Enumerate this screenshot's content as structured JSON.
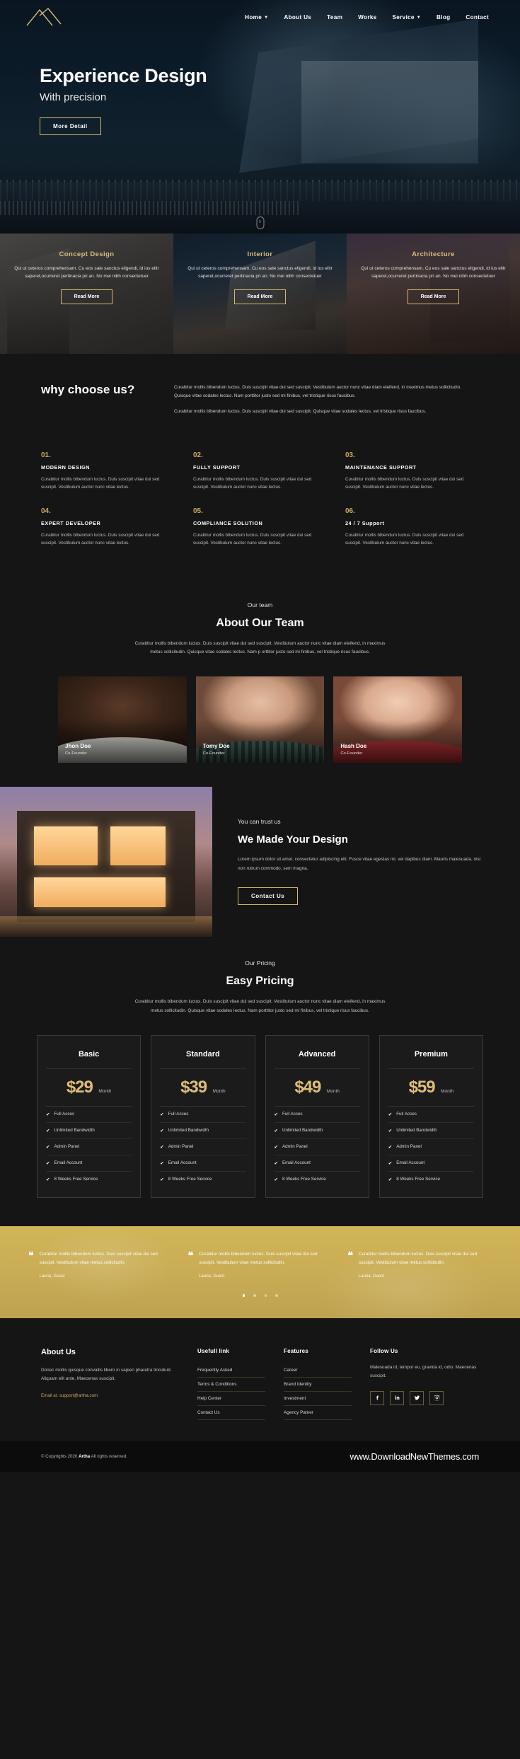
{
  "nav": {
    "logo_name": "artha-mountain-logo",
    "items": [
      {
        "label": "Home",
        "has_caret": true
      },
      {
        "label": "About Us",
        "has_caret": false
      },
      {
        "label": "Team",
        "has_caret": false
      },
      {
        "label": "Works",
        "has_caret": false
      },
      {
        "label": "Service",
        "has_caret": true
      },
      {
        "label": "Blog",
        "has_caret": false
      },
      {
        "label": "Contact",
        "has_caret": false
      }
    ]
  },
  "hero": {
    "title": "Experience Design",
    "subtitle": "With precision",
    "button": "More Detail"
  },
  "services": [
    {
      "title": "Concept Design",
      "text": "Qui ut ceteros comprehensam. Cu eos sale sanctus eligendi, id ius elitr saperet,ocurreret pertinacia pri an. No mei nibh consectetuer",
      "button": "Read More"
    },
    {
      "title": "Interior",
      "text": "Qui ut ceteros comprehensam. Cu eos sale sanctus eligendi, id ius elitr saperet,ocurreret pertinacia pri an. No mei nibh consectetuer",
      "button": "Read More"
    },
    {
      "title": "Architecture",
      "text": "Qui ut ceteros comprehensam. Cu eos sale sanctus eligendi, id ius elitr saperet,ocurreret pertinacia pri an. No mei nibh consectetuer",
      "button": "Read More"
    }
  ],
  "why": {
    "heading": "why choose us?",
    "paragraph1": "Curabitur mollis bibendum luctus. Duis suscipit vitae dui sed suscipit. Vestibulum auctor nunc vitae diam eleifend, in maximus metus sollicitudin. Quisque vitae sodales lectus. Nam porttitor justo sed mi finibus, vel tristique risus faucibus.",
    "paragraph2": "Curabitur mollis bibendum luctus. Duis suscipit vitae dui sed suscipit. Quisque vitae sodales lectus, vel tristique risus faucibus."
  },
  "features": [
    {
      "num": "01.",
      "title": "MODERN DESIGN",
      "text": "Curabitur mollis bibendum luctus. Duis suscipit vitae dui sed suscipit. Vestibulum auctor nunc vitae lectus."
    },
    {
      "num": "02.",
      "title": "FULLY SUPPORT",
      "text": "Curabitur mollis bibendum luctus. Duis suscipit vitae dui sed suscipit. Vestibulum auctor nunc vitae lectus."
    },
    {
      "num": "03.",
      "title": "MAINTENANCE SUPPORT",
      "text": "Curabitur mollis bibendum luctus. Duis suscipit vitae dui sed suscipit. Vestibulum auctor nunc vitae lectus."
    },
    {
      "num": "04.",
      "title": "EXPERT DEVELOPER",
      "text": "Curabitur mollis bibendum luctus. Duis suscipit vitae dui sed suscipit. Vestibulum auctor nunc vitae lectus."
    },
    {
      "num": "05.",
      "title": "COMPLIANCE SOLUTION",
      "text": "Curabitur mollis bibendum luctus. Duis suscipit vitae dui sed suscipit. Vestibulum auctor nunc vitae lectus."
    },
    {
      "num": "06.",
      "title": "24 / 7 Support",
      "text": "Curabitur mollis bibendum luctus. Duis suscipit vitae dui sed suscipit. Vestibulum auctor nunc vitae lectus."
    }
  ],
  "team": {
    "eyebrow": "Our team",
    "title": "About Our Team",
    "description": "Curabitur mollis bibendum luctus. Duis suscipit vitae dui sed suscipit. Vestibulum auctor nunc vitae diam eleifend, in maximus metus sollicitudin. Quisque vitae sodales lectus. Nam p orttitor justo sed mi finibus, vel tristique risus faucibus.",
    "members": [
      {
        "name": "Jhon Doe",
        "role": "Co-Founder"
      },
      {
        "name": "Tomy Doe",
        "role": "Co-Founder"
      },
      {
        "name": "Hash Doe",
        "role": "Co-Founder"
      }
    ]
  },
  "trust": {
    "eyebrow": "You can trust us",
    "title": "We Made Your Design",
    "text": "Lorem ipsum dolor sit amet, consectetur adipiscing elit. Fusce vitae egestas mi, vel dapibus diam. Mauris malesuada, nisl non rutrum commodo, sem magna.",
    "button": "Contact Us"
  },
  "pricing": {
    "eyebrow": "Our Pricing",
    "title": "Easy Pricing",
    "description": "Curabitur mollis bibendum luctus. Duis suscipit vitae dui sed suscipit. Vestibulum auctor nunc vitae diam eleifend, in maximus metus sollicitudin. Quisque vitae sodales lectus. Nam porttitor justo sed mi finibus, vel tristique risus faucibus.",
    "per": "Month",
    "plans": [
      {
        "name": "Basic",
        "price": "$29",
        "features": [
          "Full Acces",
          "Unlimited Bandwidth",
          "Admin Panel",
          "Email Account",
          "8 Weeks Free Service"
        ]
      },
      {
        "name": "Standard",
        "price": "$39",
        "features": [
          "Full Acces",
          "Unlimited Bandwidth",
          "Admin Panel",
          "Email Account",
          "8 Weeks Free Service"
        ]
      },
      {
        "name": "Advanced",
        "price": "$49",
        "features": [
          "Full Acces",
          "Unlimited Bandwidth",
          "Admin Panel",
          "Email Account",
          "8 Weeks Free Service"
        ]
      },
      {
        "name": "Premium",
        "price": "$59",
        "features": [
          "Full Acces",
          "Unlimited Bandwidth",
          "Admin Panel",
          "Email Account",
          "8 Weeks Free Service"
        ]
      }
    ]
  },
  "testimonials": {
    "items": [
      {
        "text": "Curabitur mollis bibendum luctus. Duis suscipit vitae dui sed suscipit. Vestibulum vitae metus sollicitudin.",
        "author": "Lauria, Guest"
      },
      {
        "text": "Curabitur mollis bibendum luctus. Duis suscipit vitae dui sed suscipit. Vestibulum vitae metus sollicitudin.",
        "author": "Lauria, Guest"
      },
      {
        "text": "Curabitur mollis bibendum luctus. Duis suscipit vitae dui sed suscipit. Vestibulum vitae metus sollicitudin.",
        "author": "Lauria, Guest"
      }
    ],
    "dots": 4,
    "active_dot": 0,
    "accent_color": "#c9ac55"
  },
  "footer": {
    "about": {
      "heading": "About Us",
      "text": "Donec mollis quisque convallis libero in sapien pharetra tincidunt. Aliquam elit ante, Maecenas suscipit.",
      "email": "Email at. support@artha.com"
    },
    "useful": {
      "heading": "Usefull link",
      "links": [
        "Frequently Asked",
        "Terms & Conditions",
        "Help Center",
        "Contact Us"
      ]
    },
    "features": {
      "heading": "Features",
      "links": [
        "Career",
        "Brand Identity",
        "Investment",
        "Agency Patner"
      ]
    },
    "follow": {
      "heading": "Follow Us",
      "text": "Malesuada id, tempor eu, gravida id, odio. Maecenas suscipit.",
      "socials": [
        "facebook-icon",
        "linkedin-icon",
        "twitter-icon",
        "instagram-icon"
      ]
    }
  },
  "copyright": {
    "prefix": "© Copyrights 2020",
    "brand": "Artha",
    "suffix": "All rights reserved.",
    "site": "www.DownloadNewThemes.com"
  }
}
